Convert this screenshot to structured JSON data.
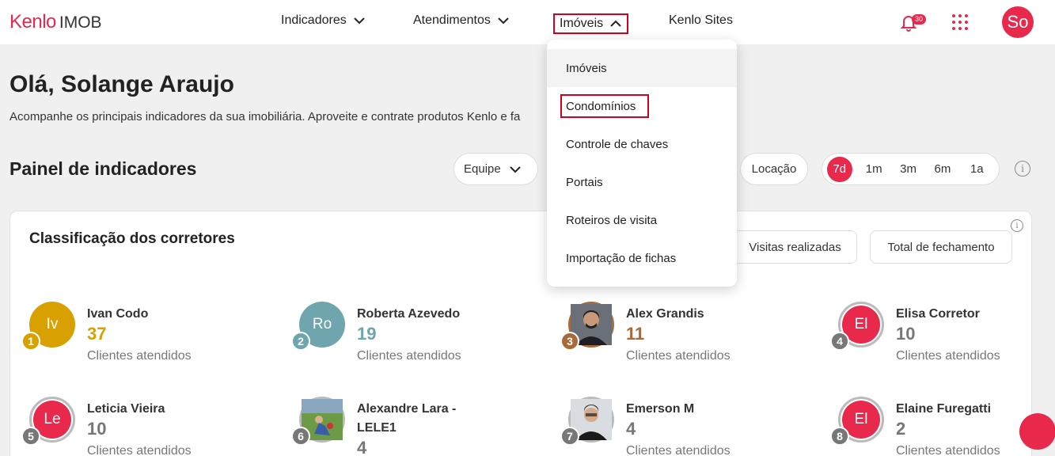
{
  "brand": {
    "kenlo": "Kenlo",
    "imob": "IMOB"
  },
  "nav": {
    "indicadores": "Indicadores",
    "atendimentos": "Atendimentos",
    "imoveis": "Imóveis",
    "kenlo_sites": "Kenlo Sites"
  },
  "notifications": {
    "count": "30"
  },
  "user": {
    "initials": "So"
  },
  "greeting": "Olá, Solange Araujo",
  "subtitle": "Acompanhe os principais indicadores da sua imobiliária. Aproveite e contrate produtos Kenlo e fa",
  "panel": {
    "title": "Painel de indicadores",
    "equipe": "Equipe",
    "locacao": "Locação",
    "periods": [
      "7d",
      "1m",
      "3m",
      "6m",
      "1a"
    ]
  },
  "card": {
    "title": "Classificação dos corretores",
    "btn_visitas": "Visitas realizadas",
    "btn_total": "Total de fechamento"
  },
  "brokers": [
    {
      "rank": "1",
      "initials": "Iv",
      "name": "Ivan Codo",
      "count": "37",
      "label": "Clientes atendidos",
      "color": "#d8a000"
    },
    {
      "rank": "2",
      "initials": "Ro",
      "name": "Roberta Azevedo",
      "count": "19",
      "label": "Clientes atendidos",
      "color": "#6fa5ad"
    },
    {
      "rank": "3",
      "initials": "",
      "name": "Alex Grandis",
      "count": "11",
      "label": "Clientes atendidos",
      "color": "#a86a3a"
    },
    {
      "rank": "4",
      "initials": "El",
      "name": "Elisa Corretor",
      "count": "10",
      "label": "Clientes atendidos",
      "color": "#777777"
    },
    {
      "rank": "5",
      "initials": "Le",
      "name": "Leticia Vieira",
      "count": "10",
      "label": "Clientes atendidos",
      "color": "#777777"
    },
    {
      "rank": "6",
      "initials": "",
      "name": "Alexandre Lara - LELE1",
      "count": "4",
      "label": "",
      "color": "#777777"
    },
    {
      "rank": "7",
      "initials": "",
      "name": "Emerson M",
      "count": "4",
      "label": "Clientes atendidos",
      "color": "#777777"
    },
    {
      "rank": "8",
      "initials": "El",
      "name": "Elaine Furegatti",
      "count": "2",
      "label": "Clientes atendidos",
      "color": "#777777"
    }
  ],
  "dropdown": {
    "items": [
      "Imóveis",
      "Condomínios",
      "Controle de chaves",
      "Portais",
      "Roteiros de visita",
      "Importação de fichas"
    ]
  },
  "info_glyph": "i"
}
